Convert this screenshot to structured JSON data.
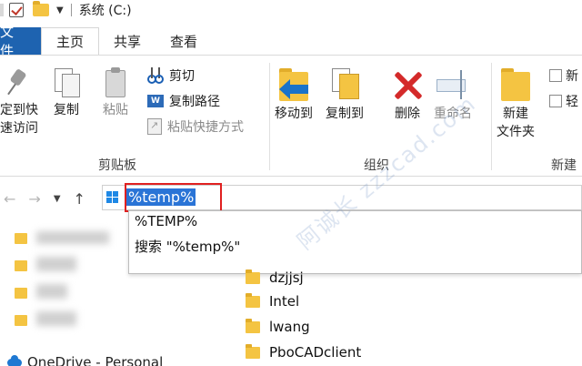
{
  "window": {
    "title": "系统 (C:)"
  },
  "tabs": [
    {
      "label": "文件"
    },
    {
      "label": "主页"
    },
    {
      "label": "共享"
    },
    {
      "label": "查看"
    }
  ],
  "clipboard": {
    "pin_label": "定到快\n速访问",
    "copy_label": "复制",
    "paste_label": "粘贴",
    "cut_label": "剪切",
    "copy_path_label": "复制路径",
    "paste_shortcut_label": "粘贴快捷方式",
    "group_label": "剪贴板"
  },
  "organize": {
    "move_to_label": "移动到",
    "copy_to_label": "复制到",
    "delete_label": "删除",
    "rename_label": "重命名",
    "group_label": "组织"
  },
  "new_group": {
    "new_folder_label": "新建\n文件夹",
    "new_item_label": "新",
    "easy_access_label": "轻",
    "group_label": "新建"
  },
  "address": {
    "value": "%temp%"
  },
  "autocomplete": {
    "items": [
      "%TEMP%",
      "搜索 \"%temp%\""
    ]
  },
  "folders": [
    "dzjjsj",
    "Intel",
    "lwang",
    "PboCADclient"
  ],
  "nav_pane": {
    "onedrive_label": "OneDrive - Personal"
  },
  "watermark": "阿诚长 zzzcad.com"
}
